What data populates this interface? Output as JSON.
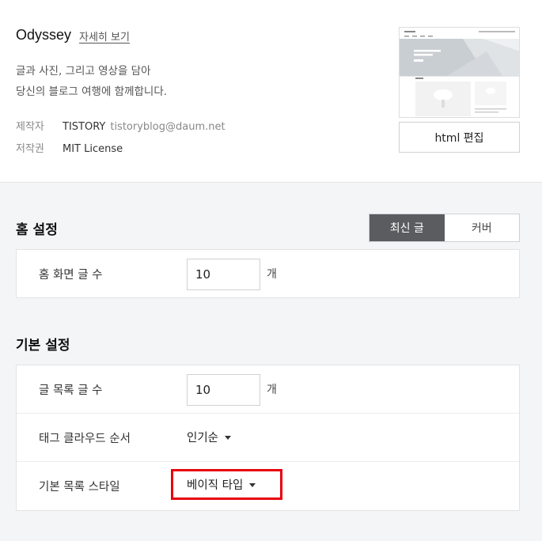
{
  "theme": {
    "name": "Odyssey",
    "detail_link": "자세히 보기",
    "desc_line1": "글과 사진, 그리고 영상을 담아",
    "desc_line2": "당신의 블로그 여행에 함께합니다.",
    "maker_label": "제작자",
    "maker_value": "TISTORY",
    "maker_email": "tistoryblog@daum.net",
    "license_label": "저작권",
    "license_value": "MIT License",
    "html_edit_button": "html 편집"
  },
  "home_settings": {
    "title": "홈 설정",
    "tabs": [
      "최신 글",
      "커버"
    ],
    "selected_tab": "최신 글",
    "post_count_label": "홈 화면 글 수",
    "post_count_value": "10",
    "unit": "개"
  },
  "basic_settings": {
    "title": "기본 설정",
    "list_count_label": "글 목록 글 수",
    "list_count_value": "10",
    "unit": "개",
    "tag_cloud_label": "태그 클라우드 순서",
    "tag_cloud_value": "인기순",
    "list_style_label": "기본 목록 스타일",
    "list_style_value": "베이직 타입"
  },
  "colors": {
    "highlight": "#e8000b",
    "active_tab": "#5b5c60"
  }
}
